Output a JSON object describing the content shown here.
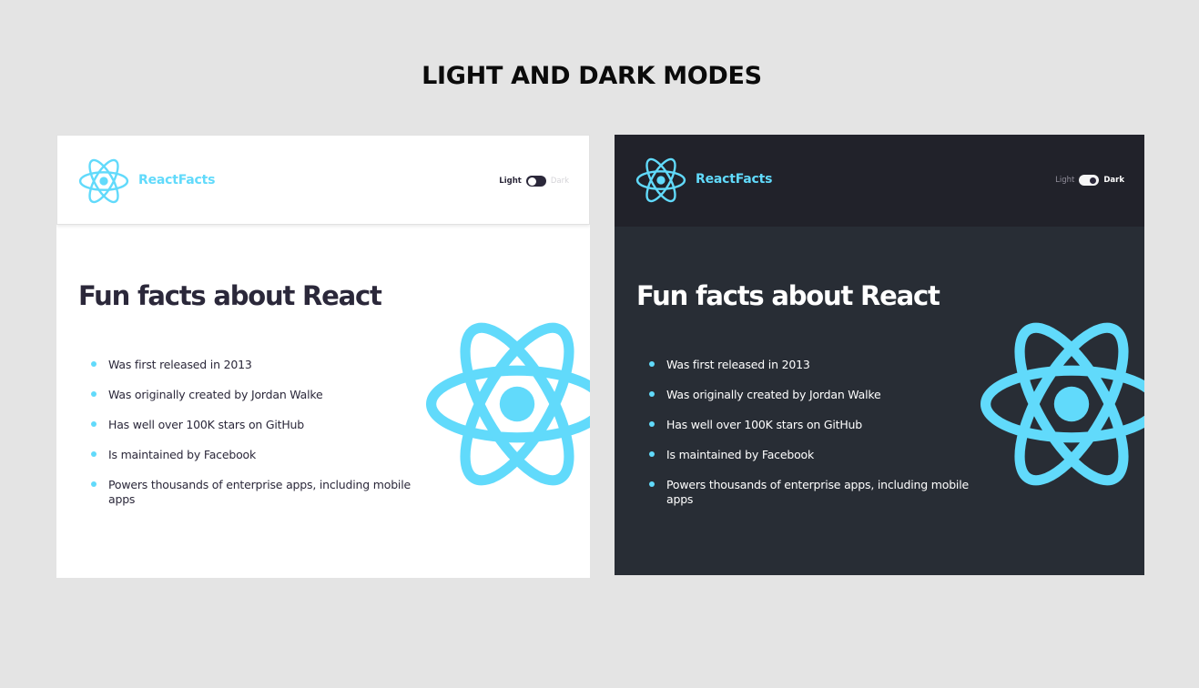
{
  "showcase": {
    "title": "LIGHT AND DARK MODES"
  },
  "colors": {
    "accent": "#61dafb",
    "background_page": "#e4e4e4",
    "light_panel_bg": "#ffffff",
    "dark_panel_bg": "#282d35",
    "dark_navbar_bg": "#21222a",
    "light_text": "#2b283a",
    "dark_text": "#ffffff"
  },
  "light_mode": {
    "navbar": {
      "logo_icon": "react-logo-icon",
      "brand": "ReactFacts",
      "toggle": {
        "left_label": "Light",
        "right_label": "Dark",
        "state": "light"
      }
    },
    "main": {
      "heading": "Fun facts about React",
      "facts": [
        "Was first released in 2013",
        "Was originally created by Jordan Walke",
        "Has well over 100K stars on GitHub",
        "Is maintained by Facebook",
        "Powers thousands of enterprise apps, including mobile apps"
      ],
      "background_icon": "react-logo-icon"
    }
  },
  "dark_mode": {
    "navbar": {
      "logo_icon": "react-logo-icon",
      "brand": "ReactFacts",
      "toggle": {
        "left_label": "Light",
        "right_label": "Dark",
        "state": "dark"
      }
    },
    "main": {
      "heading": "Fun facts about React",
      "facts": [
        "Was first released in 2013",
        "Was originally created by Jordan Walke",
        "Has well over 100K stars on GitHub",
        "Is maintained by Facebook",
        "Powers thousands of enterprise apps, including mobile apps"
      ],
      "background_icon": "react-logo-icon"
    }
  }
}
